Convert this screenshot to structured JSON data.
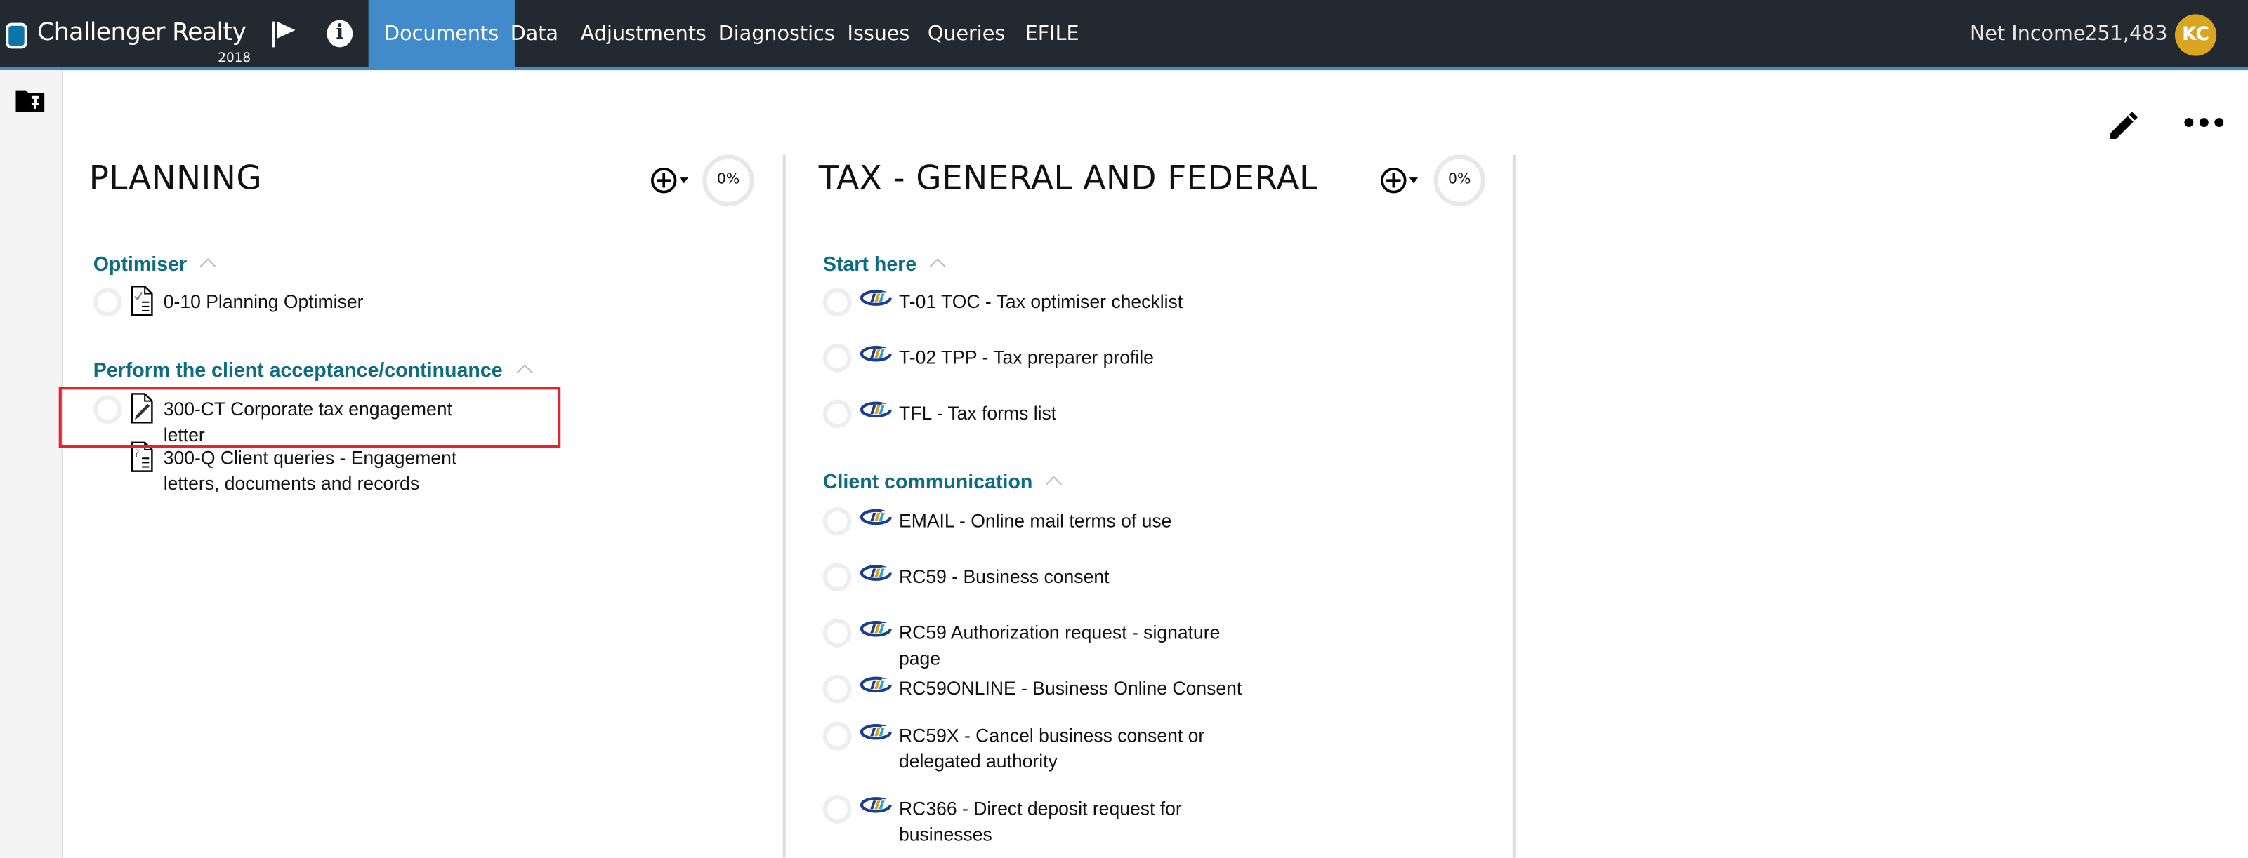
{
  "header": {
    "app_title": "Challenger Realty",
    "year": "2018",
    "tabs": [
      {
        "label": "Documents",
        "active": true
      },
      {
        "label": "Data"
      },
      {
        "label": "Adjustments"
      },
      {
        "label": "Diagnostics"
      },
      {
        "label": "Issues"
      },
      {
        "label": "Queries"
      },
      {
        "label": "EFILE"
      }
    ],
    "net_income_label": "Net Income",
    "net_income_value": "251,483",
    "avatar_initials": "KC",
    "accent_color": "#428bca",
    "avatar_color": "#daa520"
  },
  "columns": [
    {
      "title": "PLANNING",
      "progress": "0%",
      "sections": [
        {
          "heading": "Optimiser",
          "items": [
            {
              "label": "0-10 Planning Optimiser",
              "icon": "checklist-doc-icon",
              "radio": true
            }
          ]
        },
        {
          "heading": "Perform the client acceptance/continuance",
          "items": [
            {
              "label": "300-CT Corporate tax engagement letter",
              "icon": "edit-doc-icon",
              "radio": true,
              "highlighted": true
            },
            {
              "label": "300-Q Client queries - Engagement letters, documents and records",
              "icon": "query-doc-icon",
              "radio": false
            }
          ]
        }
      ]
    },
    {
      "title": "TAX - GENERAL AND FEDERAL",
      "progress": "0%",
      "sections": [
        {
          "heading": "Start here",
          "items": [
            {
              "label": "T-01 TOC - Tax optimiser checklist",
              "icon": "taxprep-logo-icon",
              "radio": true
            },
            {
              "label": "T-02 TPP - Tax preparer profile",
              "icon": "taxprep-logo-icon",
              "radio": true
            },
            {
              "label": "TFL - Tax forms list",
              "icon": "taxprep-logo-icon",
              "radio": true
            }
          ]
        },
        {
          "heading": "Client communication",
          "items": [
            {
              "label": "EMAIL - Online mail terms of use",
              "icon": "taxprep-logo-icon",
              "radio": true
            },
            {
              "label": "RC59 - Business consent",
              "icon": "taxprep-logo-icon",
              "radio": true
            },
            {
              "label": "RC59 Authorization request - signature page",
              "icon": "taxprep-logo-icon",
              "radio": true
            },
            {
              "label": "RC59ONLINE - Business Online Consent",
              "icon": "taxprep-logo-icon",
              "radio": true
            },
            {
              "label": "RC59X - Cancel business consent or delegated authority",
              "icon": "taxprep-logo-icon",
              "radio": true
            },
            {
              "label": "RC366 - Direct deposit request for businesses",
              "icon": "taxprep-logo-icon",
              "radio": true
            }
          ]
        }
      ]
    }
  ]
}
